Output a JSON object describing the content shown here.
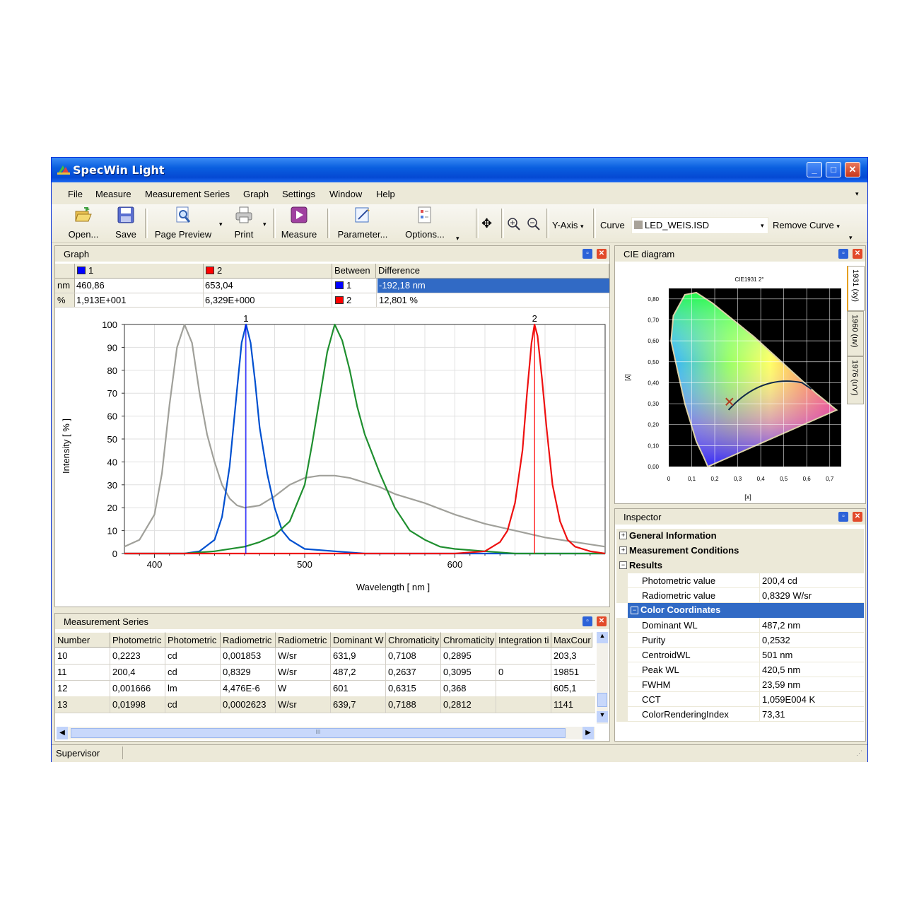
{
  "app": {
    "title": "SpecWin Light"
  },
  "menu": [
    "File",
    "Measure",
    "Measurement Series",
    "Graph",
    "Settings",
    "Window",
    "Help"
  ],
  "toolbar": {
    "open": "Open...",
    "save": "Save",
    "page_preview": "Page Preview",
    "print": "Print",
    "measure": "Measure",
    "parameter": "Parameter...",
    "options": "Options...",
    "y_axis": "Y-Axis",
    "curve_label": "Curve",
    "curve_value": "LED_WEIS.ISD",
    "remove_curve": "Remove Curve"
  },
  "graph_panel": {
    "title": "Graph",
    "cursor_table": {
      "col1": "1",
      "col2": "2",
      "between": "Between",
      "difference": "Difference",
      "row_nm": {
        "unit": "nm",
        "v1": "460,86",
        "v2": "653,04",
        "sel": "1",
        "diff": "-192,18 nm"
      },
      "row_pct": {
        "unit": "%",
        "v1": "1,913E+001",
        "v2": "6,329E+000",
        "sel": "2",
        "diff": "12,801 %"
      }
    },
    "colors": {
      "cursor1": "#0000ff",
      "cursor2": "#ff0000"
    }
  },
  "chart_data": {
    "type": "line",
    "xlabel": "Wavelength [ nm ]",
    "ylabel": "Intensity [ % ]",
    "xlim": [
      380,
      700
    ],
    "ylim": [
      0,
      100
    ],
    "x_ticks": [
      "400",
      "500",
      "600"
    ],
    "y_ticks": [
      "0",
      "10",
      "20",
      "30",
      "40",
      "50",
      "60",
      "70",
      "80",
      "90",
      "100"
    ],
    "cursors": [
      {
        "label": "1",
        "x": 460.86
      },
      {
        "label": "2",
        "x": 653.04
      }
    ],
    "series": [
      {
        "color": "#a0a09a",
        "x": [
          380,
          390,
          400,
          405,
          410,
          415,
          420,
          425,
          430,
          435,
          440,
          445,
          450,
          455,
          460,
          470,
          480,
          490,
          500,
          510,
          520,
          530,
          540,
          550,
          560,
          580,
          600,
          620,
          640,
          660,
          680,
          700
        ],
        "values": [
          3,
          6,
          17,
          35,
          65,
          90,
          100,
          92,
          70,
          52,
          40,
          30,
          24,
          21,
          20,
          21,
          25,
          30,
          33,
          34,
          34,
          33,
          31,
          29,
          26,
          22,
          17,
          13,
          10,
          7,
          5,
          3
        ]
      },
      {
        "color": "#0050d0",
        "x": [
          380,
          420,
          430,
          440,
          445,
          450,
          455,
          458,
          461,
          464,
          467,
          470,
          475,
          480,
          485,
          490,
          500,
          520,
          540,
          560,
          700
        ],
        "values": [
          0,
          0,
          1,
          6,
          16,
          38,
          72,
          92,
          100,
          92,
          75,
          55,
          35,
          20,
          10,
          6,
          2,
          1,
          0,
          0,
          0
        ]
      },
      {
        "color": "#1f8f2f",
        "x": [
          380,
          420,
          440,
          460,
          470,
          480,
          490,
          500,
          505,
          510,
          515,
          520,
          525,
          530,
          535,
          540,
          550,
          560,
          570,
          580,
          590,
          600,
          620,
          640,
          700
        ],
        "values": [
          0,
          0,
          1,
          3,
          5,
          8,
          14,
          30,
          48,
          68,
          88,
          100,
          93,
          80,
          64,
          52,
          35,
          20,
          10,
          6,
          3,
          2,
          1,
          0,
          0
        ]
      },
      {
        "color": "#ee1010",
        "x": [
          380,
          600,
          620,
          630,
          635,
          640,
          645,
          648,
          651,
          653,
          655,
          658,
          661,
          665,
          670,
          675,
          680,
          690,
          700
        ],
        "values": [
          0,
          0,
          1,
          5,
          10,
          22,
          45,
          70,
          92,
          100,
          95,
          76,
          55,
          30,
          14,
          6,
          3,
          1,
          0
        ]
      }
    ]
  },
  "cie_panel": {
    "title": "CIE diagram",
    "plot_title": "CIE1931 2°",
    "xlabel": "[x]",
    "ylabel": "[y]",
    "x_ticks": [
      "0",
      "0,1",
      "0,2",
      "0,3",
      "0,4",
      "0,5",
      "0,6",
      "0,7"
    ],
    "y_ticks": [
      "0,00",
      "0,10",
      "0,20",
      "0,30",
      "0,40",
      "0,50",
      "0,60",
      "0,70",
      "0,80"
    ],
    "tabs": [
      "1931 (xy)",
      "1960 (uv)",
      "1976 (u'v')"
    ]
  },
  "series_panel": {
    "title": "Measurement Series",
    "columns": [
      "Number",
      "Photometric",
      "Photometric",
      "Radiometric",
      "Radiometric",
      "Dominant W",
      "Chromaticity",
      "Chromaticity",
      "Integration ti",
      "MaxCour"
    ],
    "rows": [
      [
        "10",
        "0,2223",
        "cd",
        "0,001853",
        "W/sr",
        "631,9",
        "0,7108",
        "0,2895",
        "",
        "203,3"
      ],
      [
        "11",
        "200,4",
        "cd",
        "0,8329",
        "W/sr",
        "487,2",
        "0,2637",
        "0,3095",
        "0",
        "19851"
      ],
      [
        "12",
        "0,001666",
        "lm",
        "4,476E-6",
        "W",
        "601",
        "0,6315",
        "0,368",
        "",
        "605,1"
      ],
      [
        "13",
        "0,01998",
        "cd",
        "0,0002623",
        "W/sr",
        "639,7",
        "0,7188",
        "0,2812",
        "",
        "1141"
      ]
    ],
    "scroll_grip": "III"
  },
  "inspector": {
    "title": "Inspector",
    "groups": [
      "General Information",
      "Measurement Conditions",
      "Results"
    ],
    "results": [
      {
        "name": "Photometric value",
        "value": "200,4 cd"
      },
      {
        "name": "Radiometric value",
        "value": "0,8329 W/sr"
      }
    ],
    "subgroup": "Color Coordinates",
    "color_rows": [
      {
        "name": "Dominant WL",
        "value": "487,2 nm"
      },
      {
        "name": "Purity",
        "value": "0,2532"
      },
      {
        "name": "CentroidWL",
        "value": "501 nm"
      },
      {
        "name": "Peak WL",
        "value": "420,5 nm"
      },
      {
        "name": "FWHM",
        "value": "23,59 nm"
      },
      {
        "name": "CCT",
        "value": "1,059E004 K"
      },
      {
        "name": "ColorRenderingIndex",
        "value": "73,31"
      }
    ]
  },
  "status": {
    "user": "Supervisor"
  }
}
